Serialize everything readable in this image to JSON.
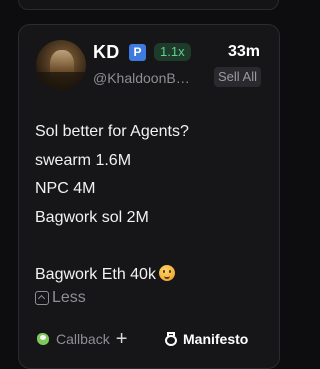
{
  "post": {
    "author_name": "KD",
    "verified_badge": "P",
    "multiplier": "1.1x",
    "time_ago": "33m",
    "handle": "@KhaldoonB…",
    "sell_all_label": "Sell All",
    "body_lines": [
      "Sol better for Agents?",
      "swearm 1.6M",
      "NPC 4M",
      "Bagwork sol 2M",
      "",
      "Bagwork Eth 40k"
    ],
    "less_label": "Less",
    "callback_label": "Callback",
    "plus_symbol": "+",
    "manifesto_label": "Manifesto"
  },
  "colors": {
    "background": "#0d0d0f",
    "card": "#161618",
    "multiplier_text": "#5fd38a",
    "multiplier_bg": "#1e3a2a",
    "verified_bg": "#3d7be0",
    "muted_text": "#8e8e95"
  },
  "icons": {
    "verified": "verified-p-icon",
    "smiley": "grinning-face-icon",
    "less": "chevron-up-box-icon",
    "callback": "callback-blob-icon",
    "manifesto": "manifesto-ring-icon"
  }
}
